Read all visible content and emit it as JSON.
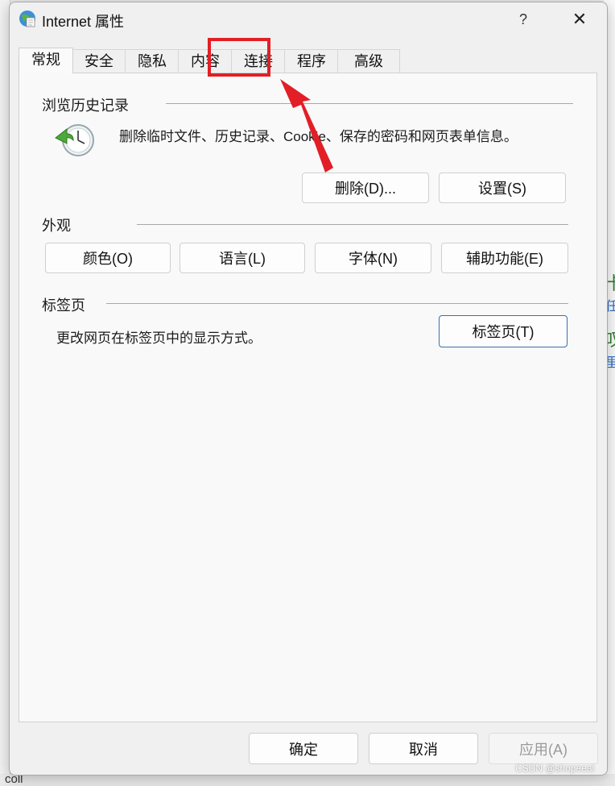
{
  "window": {
    "title": "Internet 属性",
    "help": "?",
    "close": "✕"
  },
  "tabs": [
    {
      "label": "常规"
    },
    {
      "label": "安全"
    },
    {
      "label": "隐私"
    },
    {
      "label": "内容"
    },
    {
      "label": "连接"
    },
    {
      "label": "程序"
    },
    {
      "label": "高级"
    }
  ],
  "history": {
    "title": "浏览历史记录",
    "description": "删除临时文件、历史记录、Cookie、保存的密码和网页表单信息。",
    "delete_label": "删除(D)...",
    "settings_label": "设置(S)"
  },
  "appearance": {
    "title": "外观",
    "colors_label": "颜色(O)",
    "languages_label": "语言(L)",
    "fonts_label": "字体(N)",
    "accessibility_label": "辅助功能(E)"
  },
  "tabs_section": {
    "title": "标签页",
    "description": "更改网页在标签页中的显示方式。",
    "tabs_button_label": "标签页(T)"
  },
  "footer": {
    "ok_label": "确定",
    "cancel_label": "取消",
    "apply_label": "应用(A)"
  },
  "background": {
    "right_glyph_1": "卡",
    "right_link_1": "任",
    "right_glyph_2": "叹",
    "right_link_2": "里",
    "bottom_text": "coll"
  },
  "watermark": "CSDN @shopeeai",
  "colors": {
    "annotation": "#e21f26",
    "focus_border": "#3c6fa8"
  }
}
